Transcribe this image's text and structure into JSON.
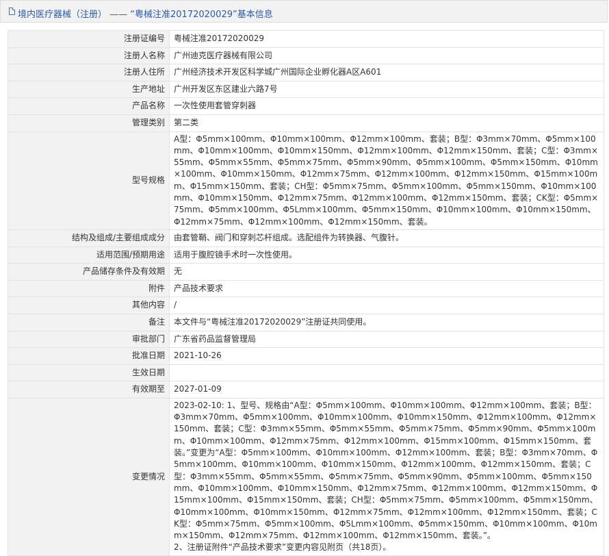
{
  "header": {
    "title": "境内医疗器械（注册）",
    "separator": " —— ",
    "subtitle": "“粤械注准20172020029”基本信息"
  },
  "rows": [
    {
      "label": "注册证编号",
      "value": "粤械注准20172020029"
    },
    {
      "label": "注册人名称",
      "value": "广州迪克医疗器械有限公司"
    },
    {
      "label": "注册人住所",
      "value": "广州经济技术开发区科学城广州国际企业孵化器A区A601"
    },
    {
      "label": "生产地址",
      "value": "广州开发区东区建业六路7号"
    },
    {
      "label": "产品名称",
      "value": "一次性使用套管穿刺器"
    },
    {
      "label": "管理类别",
      "value": "第二类"
    },
    {
      "label": "型号规格",
      "value": "A型：Φ5mm×100mm、Φ10mm×100mm、Φ12mm×100mm、套装；B型：Φ3mm×70mm、Φ5mm×100mm、Φ10mm×100mm、Φ10mm×150mm、Φ12mm×100mm、Φ12mm×150mm、套装；C型：Φ3mm×55mm、Φ5mm×55mm、Φ5mm×75mm、Φ5mm×90mm、Φ5mm×100mm、Φ5mm×150mm、Φ10mm×100mm、Φ10mm×150mm、Φ12mm×75mm、Φ12mm×100mm、Φ12mm×150mm、Φ15mm×100mm、Φ15mm×150mm、套装；CH型：Φ5mm×75mm、Φ5mm×100mm、Φ5mm×150mm、Φ10mm×100mm、Φ10mm×150mm、Φ12mm×75mm、Φ12mm×100mm、Φ12mm×150mm、套装；CK型：Φ5mm×75mm、Φ5mm×100mm、Φ5Lmm×100mm、Φ5mm×150mm、Φ10mm×100mm、Φ10mm×150mm、Φ12mm×75mm、Φ12mm×100mm、Φ12mm×150mm、套装。"
    },
    {
      "label": "结构及组成/主要组成成分",
      "value": "由套管鞘、阀门和穿刺芯杆组成。选配组件为转换器、气腹针。"
    },
    {
      "label": "适用范围/预期用途",
      "value": "适用于腹腔镜手术时一次性使用。"
    },
    {
      "label": "产品储存条件及有效期",
      "value": "无"
    },
    {
      "label": "附件",
      "value": "产品技术要求"
    },
    {
      "label": "其他内容",
      "value": "/"
    },
    {
      "label": "备注",
      "value": "本文件与“粤械注准20172020029”注册证共同使用。"
    },
    {
      "label": "审批部门",
      "value": "广东省药品监督管理局"
    },
    {
      "label": "批准日期",
      "value": "2021-10-26"
    },
    {
      "label": "生效日期",
      "value": ""
    },
    {
      "label": "有效期至",
      "value": "2027-01-09"
    },
    {
      "label": "变更情况",
      "value": "2023-02-10: 1、型号、规格由“A型：Φ5mm×100mm、Φ10mm×100mm、Φ12mm×100mm、套装；B型：Φ3mm×70mm、Φ5mm×100mm、Φ10mm×100mm、Φ10mm×150mm、Φ12mm×100mm、Φ12mm×150mm、套装；C型：Φ3mm×55mm、Φ5mm×55mm、Φ5mm×75mm、Φ5mm×90mm、Φ5mm×100mm、Φ10mm×100mm、Φ12mm×75mm、Φ12mm×100mm、Φ15mm×100mm、Φ15mm×150mm、套装。”变更为“A型：Φ5mm×100mm、Φ10mm×100mm、Φ12mm×100mm、套装；B型：Φ3mm×70mm、Φ5mm×100mm、Φ10mm×100mm、Φ10mm×150mm、Φ12mm×100mm、Φ12mm×150mm、套装；C型：Φ3mm×55mm、Φ5mm×55mm、Φ5mm×75mm、Φ5mm×90mm、Φ5mm×100mm、Φ5mm×150mm、Φ10mm×100mm、Φ10mm×150mm、Φ12mm×75mm、Φ12mm×100mm、Φ12mm×150mm、Φ15mm×100mm、Φ15mm×150mm、套装；CH型：Φ5mm×75mm、Φ5mm×100mm、Φ5mm×150mm、Φ10mm×100mm、Φ10mm×150mm、Φ12mm×75mm、Φ12mm×100mm、Φ12mm×150mm、套装；CK型：Φ5mm×75mm、Φ5mm×100mm、Φ5Lmm×100mm、Φ5mm×150mm、Φ10mm×100mm、Φ10mm×150mm、Φ12mm×75mm、Φ12mm×100mm、Φ12mm×150mm、套装。”。",
      "value2": "2、注册证附件“产品技术要求”变更内容见附页（共18页）。"
    }
  ]
}
